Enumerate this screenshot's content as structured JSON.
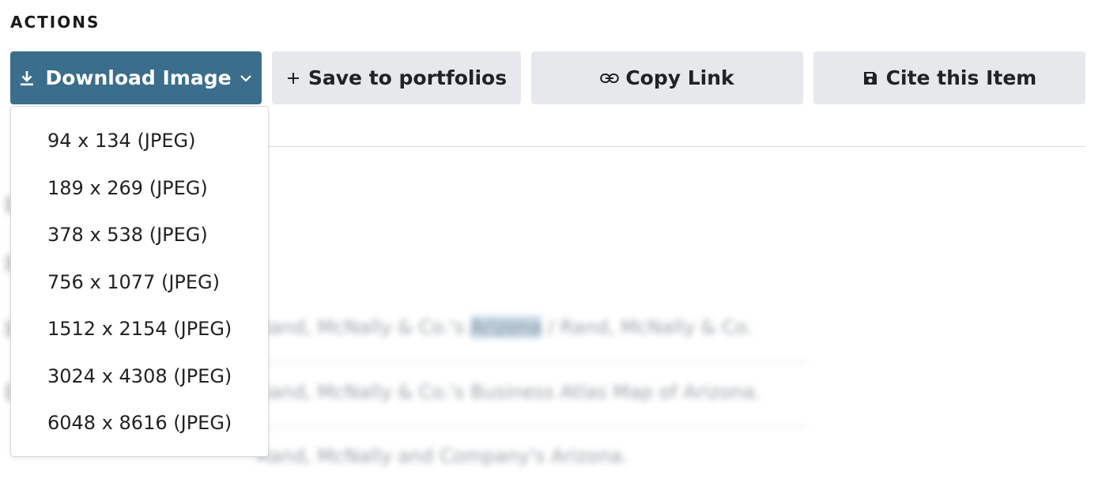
{
  "section": {
    "title": "ACTIONS"
  },
  "buttons": {
    "download": {
      "label": "Download Image",
      "icon": "download-icon",
      "chevron": "chevron-down-icon"
    },
    "save": {
      "label": "Save to portfolios",
      "icon": "plus-icon"
    },
    "copy": {
      "label": "Copy Link",
      "icon": "link-icon"
    },
    "cite": {
      "label": "Cite this Item",
      "icon": "save-disk-icon"
    }
  },
  "dropdown": {
    "items": [
      "94 x 134 (JPEG)",
      "189 x 269 (JPEG)",
      "378 x 538 (JPEG)",
      "756 x 1077 (JPEG)",
      "1512 x 2154 (JPEG)",
      "3024 x 4308 (JPEG)",
      "6048 x 8616 (JPEG)"
    ]
  },
  "background_rows": [
    {
      "pre": "Rand, McNally & Co.'s ",
      "highlight": "Arizona",
      "post": " / Rand, McNally & Co."
    },
    {
      "pre": "Rand, McNally & Co.'s Business Atlas Map of Arizona.",
      "highlight": "",
      "post": ""
    },
    {
      "pre": "Rand, McNally and Company's Arizona.",
      "highlight": "",
      "post": ""
    }
  ],
  "colors": {
    "primary": "#3b6e8c",
    "secondary": "#e6e8ec"
  }
}
